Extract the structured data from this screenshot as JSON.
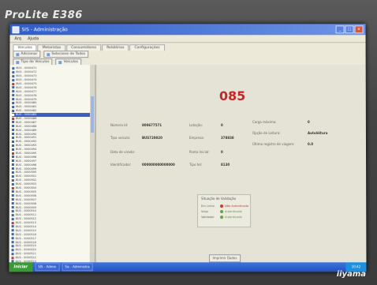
{
  "monitor": {
    "brand": "ProLite E386",
    "maker": "iiyama"
  },
  "window": {
    "title": "SIS - Administração"
  },
  "menu": [
    "Arq",
    "Ajuda"
  ],
  "tabs": [
    "Veículos",
    "Motoristas",
    "Consumidores",
    "Relatórios",
    "Configurações"
  ],
  "toolbar": {
    "row1": [
      "Adicionar",
      "Selecione de Todos"
    ],
    "row2": [
      "Tipo de Veículos",
      "Veículos"
    ]
  },
  "tree": {
    "items": [
      "BUS - 0000471",
      "BUS - 0000472",
      "BUS - 0000473",
      "BUS - 0000474",
      "BUS - 0000475",
      "BUS - 0000476",
      "BUS - 0000477",
      "BUS - 0000478",
      "BUS - 0000479",
      "BUS - 0000480",
      "BUS - 0000481",
      "BUS - 0000482",
      "BUS - 0000485",
      "BUS - 0000486",
      "BUS - 0000487",
      "BUS - 0000488",
      "BUS - 0000489",
      "BUS - 0000490",
      "BUS - 0000491",
      "BUS - 0000492",
      "BUS - 0000493",
      "BUS - 0000494",
      "BUS - 0000495",
      "BUS - 0000496",
      "BUS - 0000497",
      "BUS - 0000498",
      "BUS - 0000499",
      "BUS - 0000500",
      "BUS - 0000501",
      "BUS - 0000502",
      "BUS - 0000503",
      "BUS - 0000504",
      "BUS - 0000505",
      "BUS - 0000506",
      "BUS - 0000507",
      "BUS - 0000508",
      "BUS - 0000509",
      "BUS - 0000510",
      "BUS - 0000511",
      "BUS - 0000512",
      "BUS - 0000513",
      "BUS - 0000514",
      "BUS - 0000515",
      "BUS - 0000516",
      "BUS - 0000517",
      "BUS - 0000518",
      "BUS - 0000519",
      "BUS - 0000520",
      "BUS - 0000521",
      "BUS - 0000522",
      "BUS - 0000523"
    ],
    "selected_index": 12
  },
  "detail": {
    "number": "085",
    "fields": {
      "numero_id_label": "Número Id:",
      "numero_id_value": "800677571",
      "tipo_label": "Tipo veículo:",
      "tipo_value": "BUS720020",
      "data_label": "Data de virada:",
      "ident_label": "Identificador:",
      "ident_value": "000000000000000",
      "lotacao_label": "Lotação:",
      "lotacao_value": "0",
      "empresa_label": "Empresa:",
      "empresa_value": "378838",
      "ponto_label": "Ponto Inicial:",
      "ponto_value": "0",
      "tipo2_label": "Tipo tel:",
      "tipo2_value": "8130",
      "carga_label": "Carga máxima:",
      "carga_value": "0",
      "opcao_label": "Opção de Leitura:",
      "opcao_value": "Autoléitura",
      "ultimo_label": "Último registro de viagem:",
      "ultimo_value": "0.0"
    },
    "status_box": {
      "title": "Situação de Validação",
      "rows": [
        {
          "label": "Em Linha",
          "text": "Não Autenticado",
          "color": "#c63a2c"
        },
        {
          "label": "Viaja",
          "text": "Autenticado",
          "color": "#6a9e48"
        },
        {
          "label": "Validador",
          "text": "Autenticado",
          "color": "#6a9e48"
        }
      ]
    },
    "button": "Imprimir Dados"
  },
  "taskbar": {
    "start": "Iniciar",
    "items": [
      "SIS - Admin",
      "Sis - Administra"
    ],
    "clock": "10:42"
  }
}
